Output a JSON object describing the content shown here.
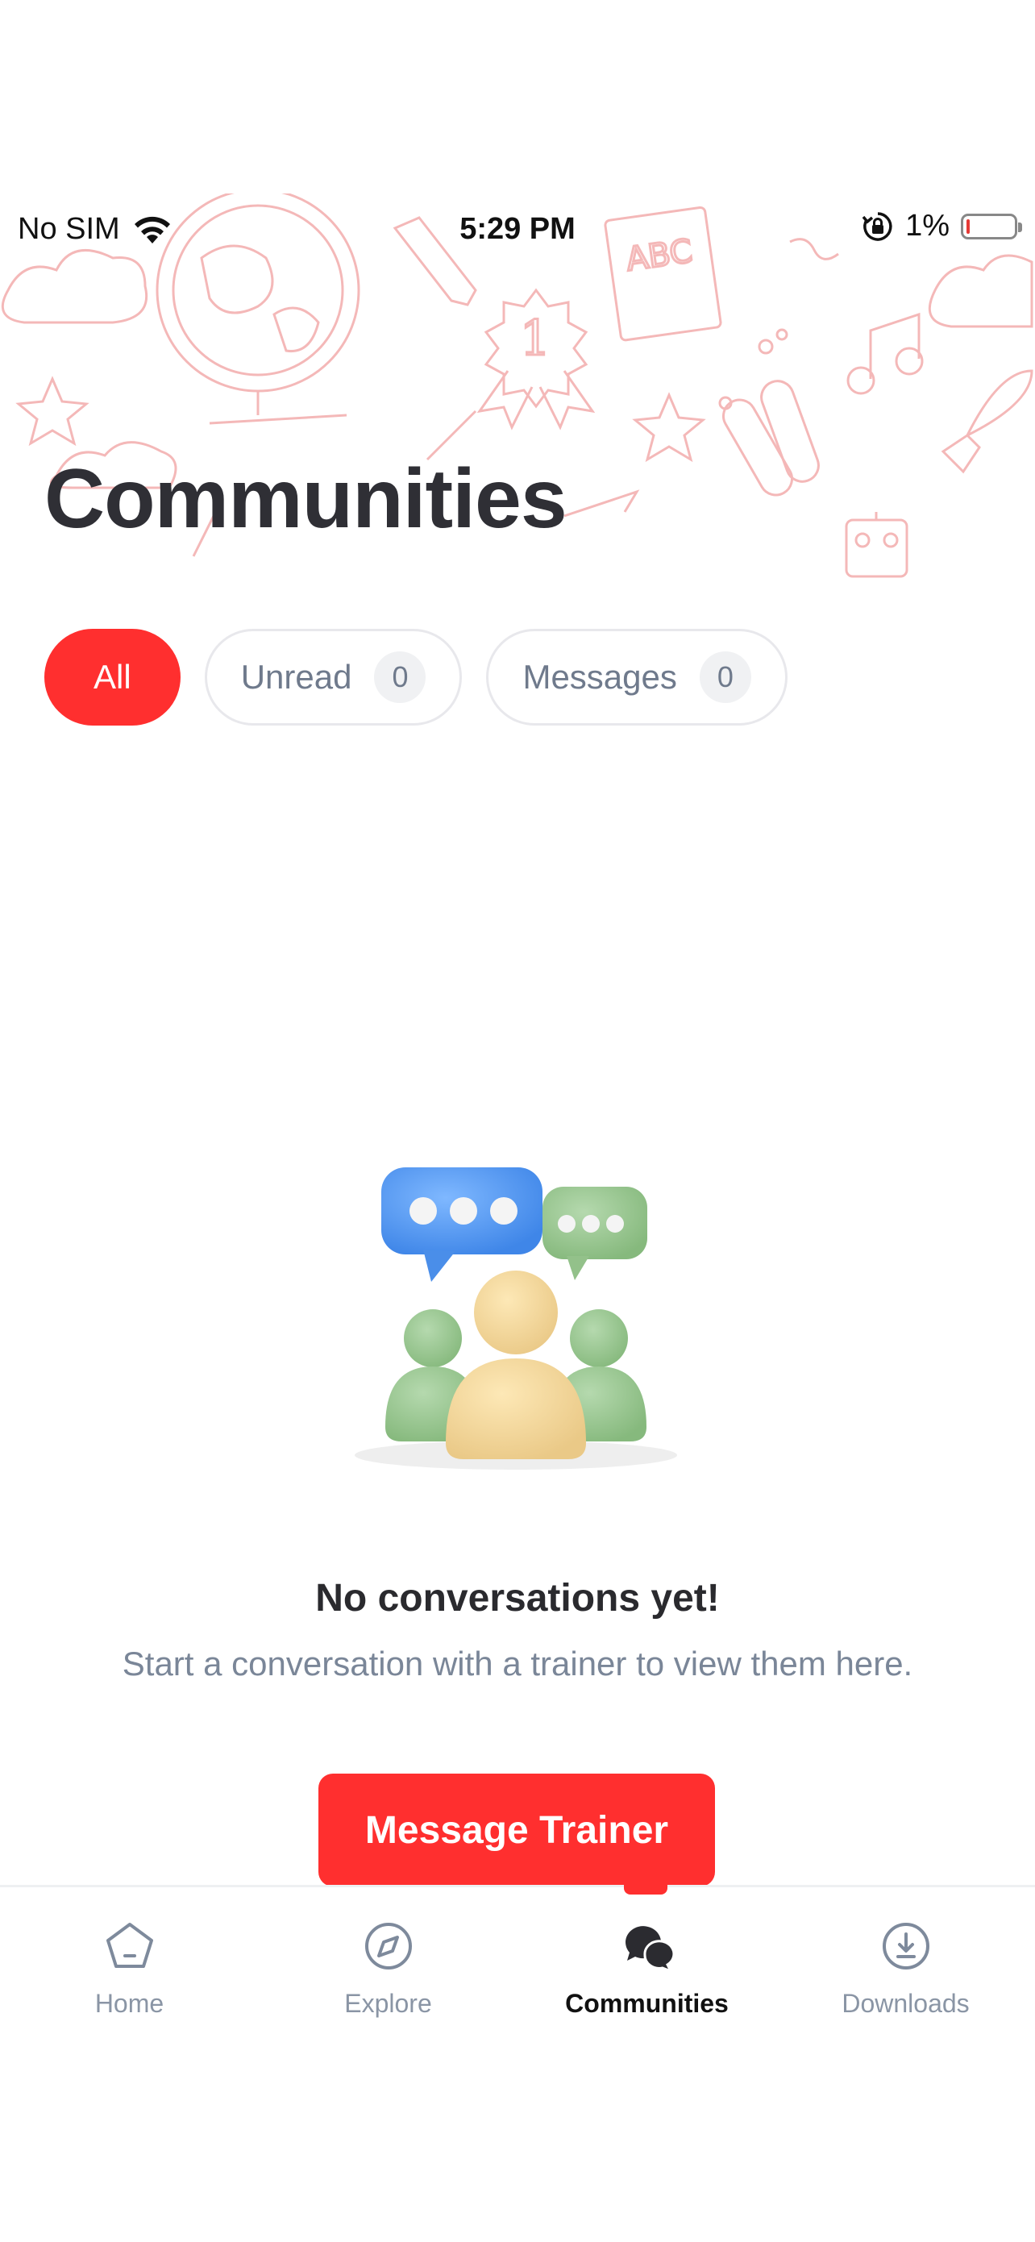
{
  "status_bar": {
    "carrier": "No SIM",
    "time": "5:29 PM",
    "battery_percent": "1%",
    "battery_level": 0.01,
    "icons": [
      "wifi-icon",
      "orientation-lock-icon",
      "battery-icon"
    ]
  },
  "header": {
    "title": "Communities"
  },
  "filters": {
    "all_label": "All",
    "unread_label": "Unread",
    "unread_count": "0",
    "messages_label": "Messages",
    "messages_count": "0",
    "active": "All"
  },
  "empty_state": {
    "title": "No conversations yet!",
    "subtitle": "Start a conversation with a trainer to view them here.",
    "illustration_icon": "community-chat-illustration"
  },
  "cta": {
    "label": "Message Trainer"
  },
  "tabbar": {
    "tabs": [
      {
        "label": "Home",
        "icon": "home-icon"
      },
      {
        "label": "Explore",
        "icon": "compass-icon"
      },
      {
        "label": "Communities",
        "icon": "chat-bubbles-icon"
      },
      {
        "label": "Downloads",
        "icon": "download-icon"
      }
    ],
    "active": "Communities"
  },
  "colors": {
    "accent": "#ff2f2f",
    "text_primary": "#2f2f35",
    "text_muted": "#7a8698",
    "doodle": "#f4b6b6"
  }
}
